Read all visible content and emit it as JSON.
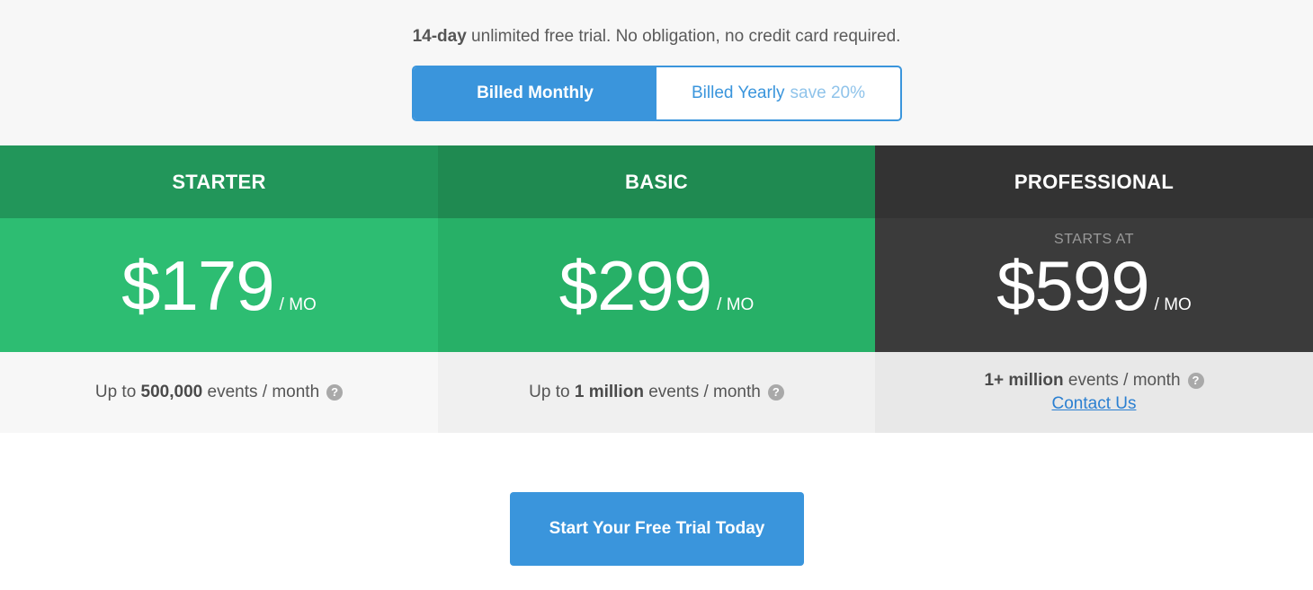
{
  "trial_note": {
    "bold": "14-day",
    "text": " unlimited free trial. No obligation, no credit card required."
  },
  "billing_toggle": {
    "monthly_label": "Billed Monthly",
    "yearly_label": "Billed Yearly",
    "yearly_save": "save 20%",
    "selected": "monthly"
  },
  "plans": [
    {
      "name": "STARTER",
      "price": "$179",
      "unit": "/ MO",
      "usage_prefix": "Up to ",
      "usage_bold": "500,000",
      "usage_suffix": " events / month"
    },
    {
      "name": "BASIC",
      "price": "$299",
      "unit": "/ MO",
      "usage_prefix": "Up to ",
      "usage_bold": "1 million",
      "usage_suffix": " events / month"
    },
    {
      "name": "PROFESSIONAL",
      "starts_at": "STARTS AT",
      "price": "$599",
      "unit": "/ MO",
      "usage_bold": "1+ million",
      "usage_suffix": " events / month",
      "contact_label": "Contact Us"
    }
  ],
  "help_icon_glyph": "?",
  "cta": {
    "label": "Start Your Free Trial Today"
  },
  "colors": {
    "accent_blue": "#3a95dc",
    "starter_green": "#2dbd72",
    "basic_green": "#27b067",
    "pro_dark": "#3b3b3b"
  }
}
